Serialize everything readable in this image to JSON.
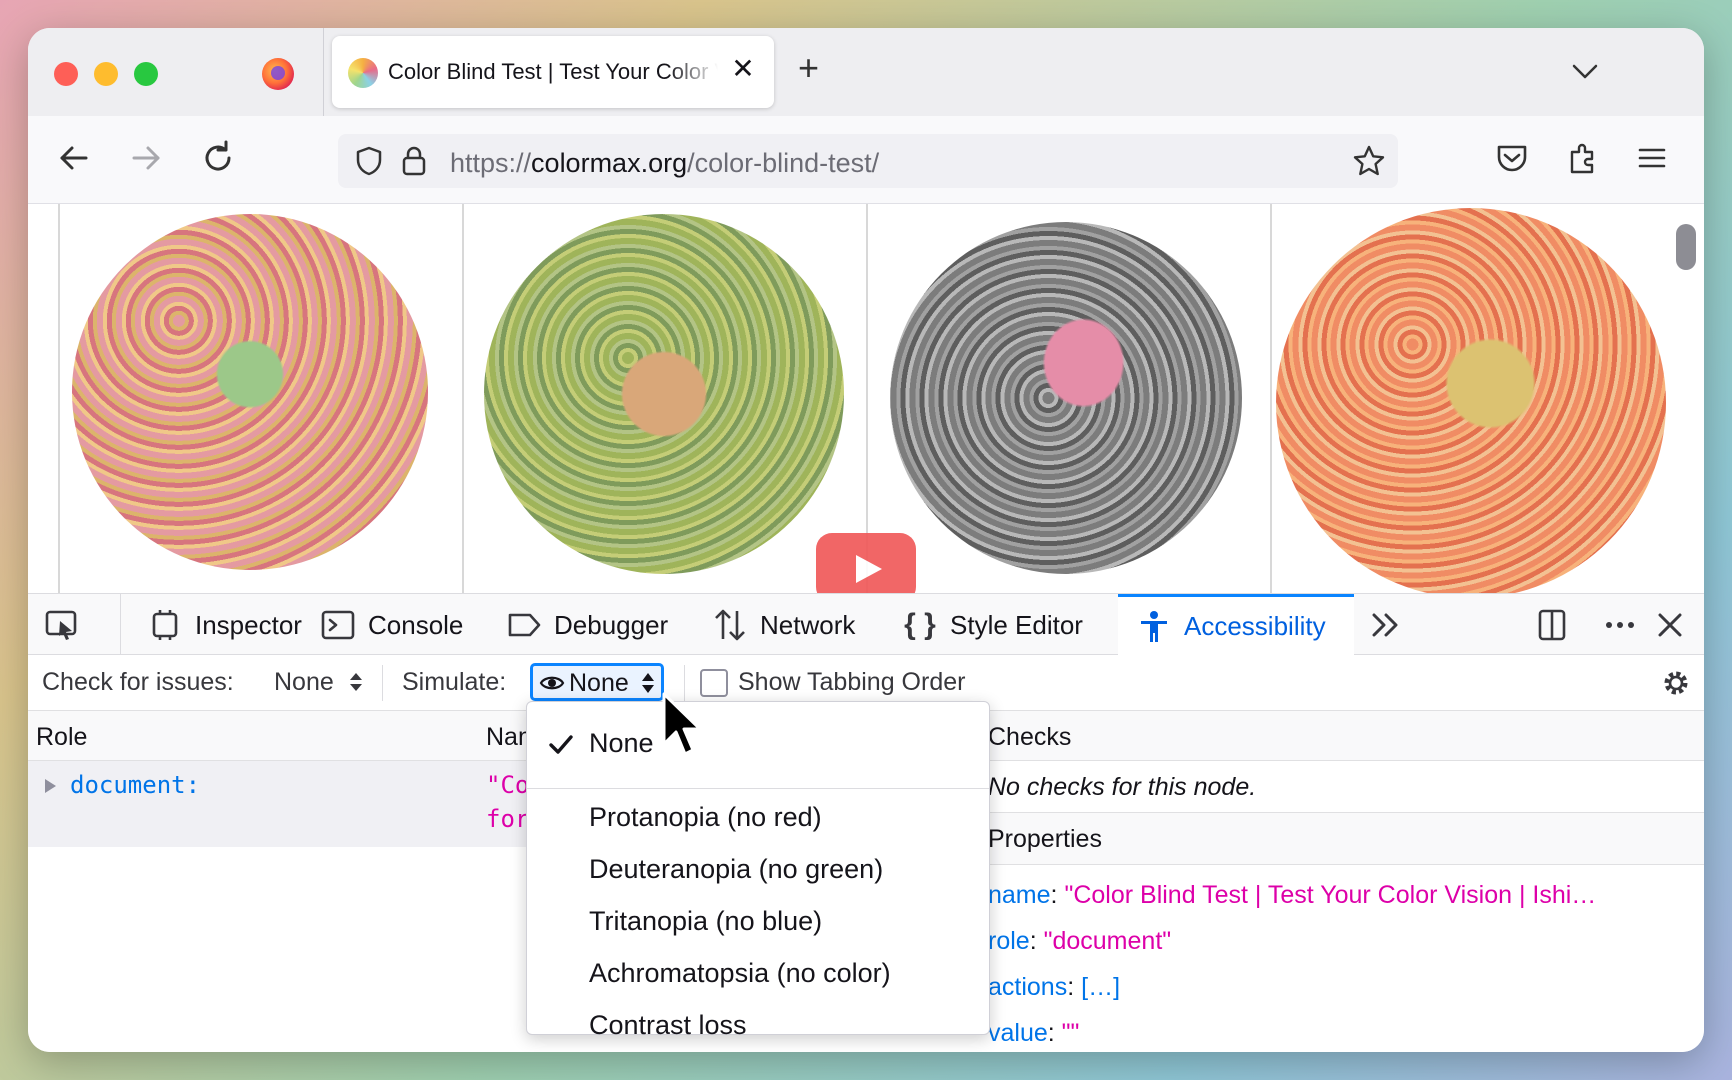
{
  "tab": {
    "title": "Color Blind Test | Test Your Color Vision | Ishihara",
    "close": "✕"
  },
  "new_tab": "+",
  "url": {
    "scheme": "https://",
    "host": "colormax.org",
    "path": "/color-blind-test/"
  },
  "devtools": {
    "tabs": [
      "Inspector",
      "Console",
      "Debugger",
      "Network",
      "Style Editor",
      "Accessibility"
    ],
    "active_tab": "Accessibility",
    "toolbar": {
      "check_label": "Check for issues:",
      "check_value": "None",
      "simulate_label": "Simulate:",
      "simulate_value": "None",
      "show_tabbing": "Show Tabbing Order"
    },
    "columns": {
      "role": "Role",
      "name": "Name",
      "checks": "Checks"
    },
    "tree": {
      "role": "document:",
      "name_line1": "\"Color",
      "name_line2": "for"
    },
    "checks_message": "No checks for this node.",
    "properties_header": "Properties",
    "properties": [
      {
        "key": "name",
        "value": "\"Color Blind Test | Test Your Color Vision | Ishi…"
      },
      {
        "key": "role",
        "value": "\"document\""
      },
      {
        "key": "actions",
        "value": "[…]"
      },
      {
        "key": "value",
        "value": "\"\""
      }
    ]
  },
  "dropdown": {
    "items": [
      "None",
      "Protanopia (no red)",
      "Deuteranopia (no green)",
      "Tritanopia (no blue)",
      "Achromatopsia (no color)",
      "Contrast loss"
    ],
    "selected": "None"
  },
  "colors": {
    "accent": "#0a84ff",
    "active_tab_text": "#0060df",
    "property_key": "#0074e8",
    "property_value": "#dd00a9"
  }
}
